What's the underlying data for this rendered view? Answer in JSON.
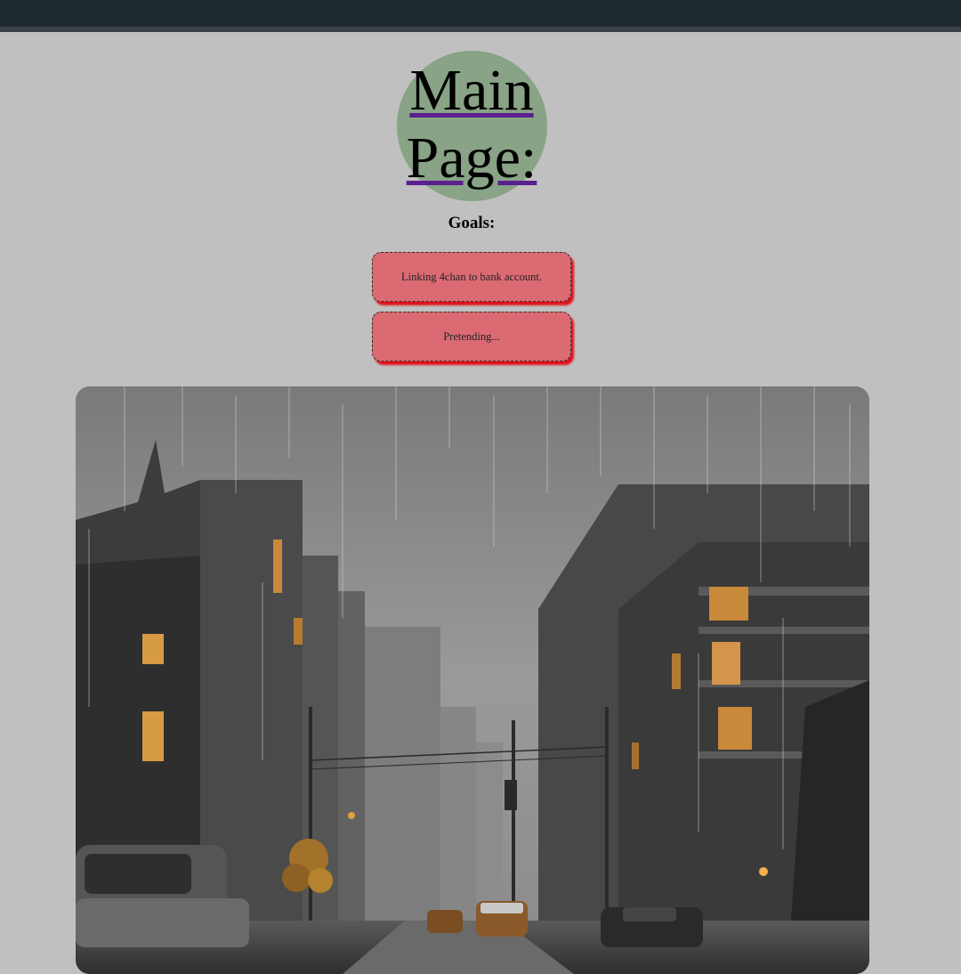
{
  "header": {
    "title_line1": "Main",
    "title_line2": "Page:"
  },
  "goals": {
    "heading": "Goals:",
    "items": [
      "Linking 4chan to bank account.",
      "Pretending..."
    ]
  },
  "colors": {
    "topbar": "#1f2a30",
    "page_background": "#c0c0c0",
    "title_circle": "#88a386",
    "link_underline": "#5b1f8f",
    "goal_card": "#dc6a73",
    "goal_shadow": "#e0101a"
  }
}
